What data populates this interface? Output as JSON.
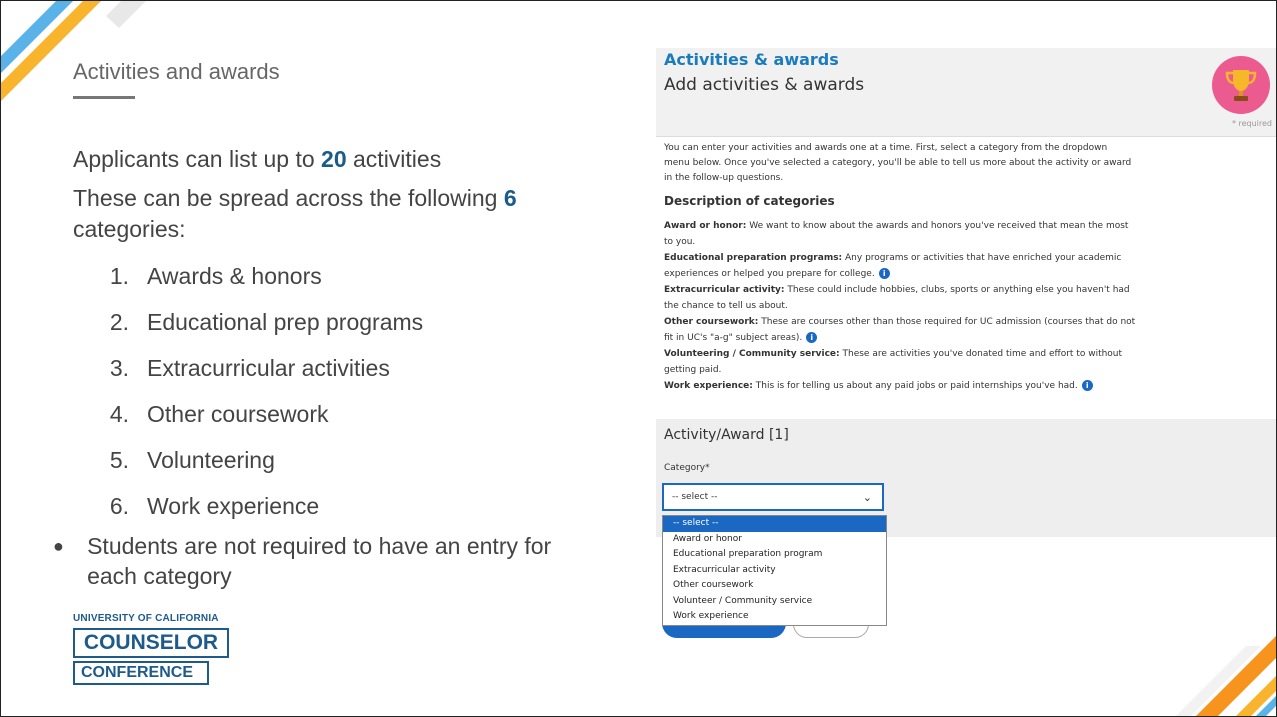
{
  "slide": {
    "title": "Activities and awards",
    "line1_before": "Applicants can list up to ",
    "line1_num": "20",
    "line1_after": " activities",
    "line2_before": "These can be spread across the following ",
    "line2_num": "6",
    "line2_after": " categories:",
    "categories": [
      {
        "num": "1.",
        "label": "Awards & honors"
      },
      {
        "num": "2.",
        "label": "Educational prep programs"
      },
      {
        "num": "3.",
        "label": "Extracurricular activities"
      },
      {
        "num": "4.",
        "label": "Other coursework"
      },
      {
        "num": "5.",
        "label": "Volunteering"
      },
      {
        "num": "6.",
        "label": "Work experience"
      }
    ],
    "bullet": "Students are not required to have an entry for each category",
    "logo_uni": "UNIVERSITY OF CALIFORNIA",
    "logo_word1": "COUNSELOR",
    "logo_word2": "CONFERENCE"
  },
  "screenshot": {
    "app_title": "Activities & awards",
    "form_title": "Add activities & awards",
    "required_note": "* required",
    "intro": "You can enter your activities and awards one at a time. First, select a category from the dropdown menu below. Once you've selected a category, you'll be able to tell us more about the activity or award in the follow-up questions.",
    "desc_heading": "Description of categories",
    "descriptions": [
      {
        "term": "Award or honor:",
        "text": " We want to know about the awards and honors you've received that mean the most to you."
      },
      {
        "term": "Educational preparation programs:",
        "text": " Any programs or activities that have enriched your academic experiences or helped you prepare for college."
      },
      {
        "term": "Extracurricular activity:",
        "text": " These could include hobbies, clubs, sports or anything else you haven't had the chance to tell us about."
      },
      {
        "term": "Other coursework:",
        "text": " These are courses other than those required for UC admission (courses that do not fit in UC's \"a-g\" subject areas)."
      },
      {
        "term": "Volunteering / Community service:",
        "text": " These are activities you've donated time and effort to without getting paid."
      },
      {
        "term": "Work experience:",
        "text": " This is for telling us about any paid jobs or paid internships you've had."
      }
    ],
    "activity_title": "Activity/Award [1]",
    "category_label": "Category*",
    "select_value": "-- select --",
    "options": [
      "-- select --",
      "Award or honor",
      "Educational preparation program",
      "Extracurricular activity",
      "Other coursework",
      "Volunteer / Community service",
      "Work experience"
    ],
    "info_glyph": "i",
    "colors": {
      "accent": "#1a68c2",
      "title_blue": "#1a7bbd",
      "highlight": "#1a5b8a"
    }
  }
}
